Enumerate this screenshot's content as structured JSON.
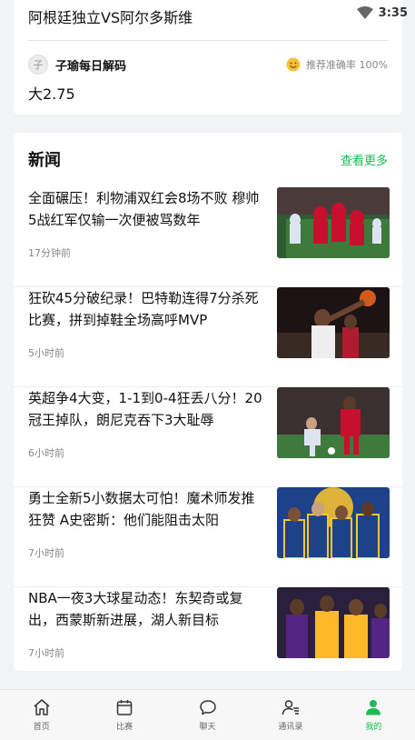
{
  "status": {
    "time": "3:35"
  },
  "pick": {
    "match": "阿根廷独立VS阿尔多斯维",
    "avatar_char": "子",
    "expert_name": "子瑜每日解码",
    "accuracy_label": "推荐准确率 100%",
    "value": "大2.75"
  },
  "news": {
    "title": "新闻",
    "more": "查看更多",
    "items": [
      {
        "headline": "全面碾压！利物浦双红会8场不败 穆帅5战红军仅输一次便被骂数年",
        "time": "17分钟前"
      },
      {
        "headline": "狂砍45分破纪录！巴特勒连得7分杀死比赛，拼到掉鞋全场高呼MVP",
        "time": "5小时前"
      },
      {
        "headline": "英超争4大变，1-1到0-4狂丢八分！20冠王掉队，朗尼克吞下3大耻辱",
        "time": "6小时前"
      },
      {
        "headline": "勇士全新5小数据太可怕！魔术师发推狂赞 A史密斯：他们能阻击太阳",
        "time": "7小时前"
      },
      {
        "headline": "NBA一夜3大球星动态！东契奇或复出，西蒙斯新进展，湖人新目标",
        "time": "7小时前"
      }
    ]
  },
  "tabs": [
    {
      "label": "首页",
      "icon": "home-icon"
    },
    {
      "label": "比赛",
      "icon": "calendar-icon"
    },
    {
      "label": "聊天",
      "icon": "chat-bubble-icon"
    },
    {
      "label": "通讯录",
      "icon": "contacts-icon"
    },
    {
      "label": "我的",
      "icon": "person-icon"
    }
  ],
  "colors": {
    "accent": "#1db954",
    "background": "#f2f3f5"
  }
}
